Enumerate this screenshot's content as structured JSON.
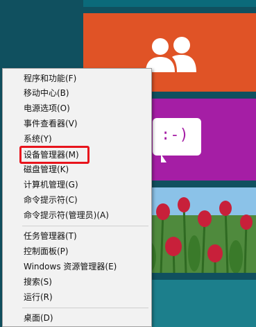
{
  "tiles": {
    "messaging": {
      "emoticon": ":-)"
    }
  },
  "context_menu": {
    "items": [
      "程序和功能(F)",
      "移动中心(B)",
      "电源选项(O)",
      "事件查看器(V)",
      "系统(Y)",
      "设备管理器(M)",
      "磁盘管理(K)",
      "计算机管理(G)",
      "命令提示符(C)",
      "命令提示符(管理员)(A)",
      "任务管理器(T)",
      "控制面板(P)",
      "Windows 资源管理器(E)",
      "搜索(S)",
      "运行(R)",
      "桌面(D)"
    ],
    "highlighted_item": "设备管理器(M)",
    "highlight_color": "#e8141c"
  },
  "colors": {
    "people_tile": "#e05326",
    "messaging_tile": "#a51ea5",
    "desktop_bg": "#10505f"
  }
}
